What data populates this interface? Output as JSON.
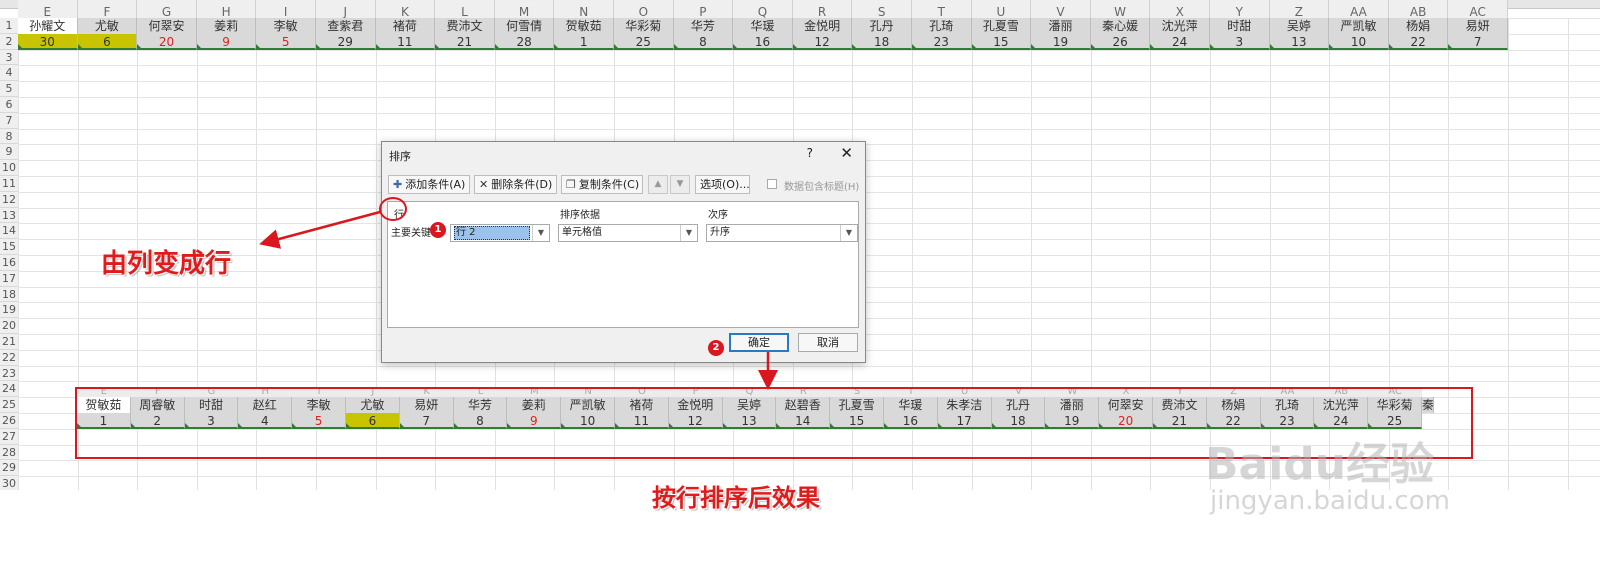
{
  "spreadsheet": {
    "column_letters": [
      "E",
      "F",
      "G",
      "H",
      "I",
      "J",
      "K",
      "L",
      "M",
      "N",
      "O",
      "P",
      "Q",
      "R",
      "S",
      "T",
      "U",
      "V",
      "W",
      "X",
      "Y",
      "Z",
      "AA",
      "AB",
      "AC"
    ],
    "row_numbers": [
      "1",
      "2",
      "3",
      "4",
      "5",
      "6",
      "7",
      "8",
      "9",
      "10",
      "11",
      "12",
      "13",
      "14",
      "15",
      "16",
      "17",
      "18",
      "19",
      "20",
      "21",
      "22",
      "23",
      "24",
      "25",
      "26",
      "27",
      "28",
      "29",
      "30"
    ],
    "row1_names": [
      "孙耀文",
      "尤敏",
      "何翠安",
      "姜莉",
      "李敏",
      "查紫君",
      "褚荷",
      "费沛文",
      "何雪倩",
      "贺敏茹",
      "华彩菊",
      "华芳",
      "华瑗",
      "金悦明",
      "孔丹",
      "孔琦",
      "孔夏雪",
      "潘丽",
      "秦心媛",
      "沈光萍",
      "时甜",
      "吴婷",
      "严凯敏",
      "杨娟",
      "易妍"
    ],
    "row2_values": [
      "30",
      "6",
      "20",
      "9",
      "5",
      "29",
      "11",
      "21",
      "28",
      "1",
      "25",
      "8",
      "16",
      "12",
      "18",
      "23",
      "15",
      "19",
      "26",
      "24",
      "3",
      "13",
      "10",
      "22",
      "7"
    ],
    "row2_red_indices": [
      2,
      3,
      4
    ],
    "row2_highlight_indices": [
      0,
      1
    ],
    "bottom_column_letters": [
      "E",
      "F",
      "G",
      "H",
      "I",
      "J",
      "K",
      "L",
      "M",
      "N",
      "O",
      "P",
      "Q",
      "R",
      "S",
      "T",
      "U",
      "V",
      "W",
      "X",
      "Y",
      "Z",
      "AA",
      "AB",
      "AC"
    ],
    "row25_names": [
      "贺敏茹",
      "周睿敏",
      "时甜",
      "赵红",
      "李敏",
      "尤敏",
      "易妍",
      "华芳",
      "姜莉",
      "严凯敏",
      "褚荷",
      "金悦明",
      "吴婷",
      "赵碧香",
      "孔夏雪",
      "华瑗",
      "朱孝洁",
      "孔丹",
      "潘丽",
      "何翠安",
      "费沛文",
      "杨娟",
      "孔琦",
      "沈光萍",
      "华彩菊",
      "秦"
    ],
    "row26_values": [
      "1",
      "2",
      "3",
      "4",
      "5",
      "6",
      "7",
      "8",
      "9",
      "10",
      "11",
      "12",
      "13",
      "14",
      "15",
      "16",
      "17",
      "18",
      "19",
      "20",
      "21",
      "22",
      "23",
      "24",
      "25"
    ],
    "row26_red_indices": [
      4,
      8,
      19
    ],
    "row26_highlight_indices": [
      5
    ]
  },
  "dialog": {
    "title": "排序",
    "help": "?",
    "close": "✕",
    "add_condition": "添加条件(A)",
    "delete_condition": "删除条件(D)",
    "copy_condition": "复制条件(C)",
    "move_up": "▲",
    "move_down": "▼",
    "options": "选项(O)...",
    "header_checkbox_label": "数据包含标题(H)",
    "column_header_row": "行",
    "column_header_sort_on": "排序依据",
    "column_header_order": "次序",
    "primary_key_label": "主要关键字",
    "primary_key_value": "行 2",
    "sort_on_value": "单元格值",
    "order_value": "升序",
    "ok": "确定",
    "cancel": "取消"
  },
  "annotations": {
    "badge1": "1",
    "badge2": "2",
    "col_to_row": "由列变成行",
    "after_sort": "按行排序后效果"
  },
  "watermark": {
    "logo": "Baidu经验",
    "url": "jingyan.baidu.com"
  },
  "colors": {
    "accent_red": "#d8181e",
    "highlight_yellow": "#c9c400",
    "cell_green_border": "#2e7d32",
    "primary_button_border": "#2b78c5"
  }
}
